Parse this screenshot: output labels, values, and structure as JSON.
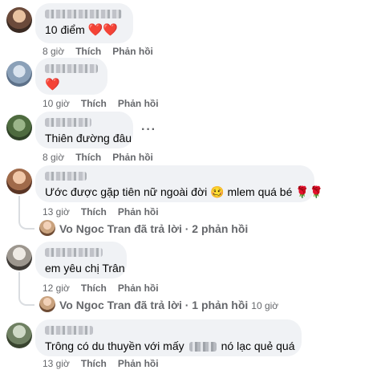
{
  "comments": [
    {
      "text": "10 điểm",
      "emoji": "❤️❤️",
      "meta": {
        "time": "8 giờ",
        "like": "Thích",
        "reply": "Phản hồi"
      }
    },
    {
      "text": "",
      "emoji": "❤️",
      "meta": {
        "time": "10 giờ",
        "like": "Thích",
        "reply": "Phản hồi"
      }
    },
    {
      "text": "Thiên đường đâu",
      "meta": {
        "time": "8 giờ",
        "like": "Thích",
        "reply": "Phản hồi"
      },
      "more": "···"
    },
    {
      "text": "Ước được gặp tiên nữ ngoài đời",
      "emoji_a": "🥴",
      "text_b": "mlem quá bé",
      "emoji_b": "🌹🌹",
      "meta": {
        "time": "13 giờ",
        "like": "Thích",
        "reply": "Phản hồi"
      },
      "replies": {
        "label": "Vo Ngoc Tran đã trả lời · 2 phản hồi"
      }
    },
    {
      "text": "em yêu chị Trân",
      "meta": {
        "time": "12 giờ",
        "like": "Thích",
        "reply": "Phản hồi"
      },
      "replies": {
        "label": "Vo Ngoc Tran đã trả lời · 1 phản hồi",
        "time": "10 giờ"
      }
    },
    {
      "text_a": "Trông có du thuyền với mấy",
      "text_b": "nó lạc quẻ quá",
      "meta": {
        "time": "13 giờ",
        "like": "Thích",
        "reply": "Phản hồi"
      }
    }
  ]
}
